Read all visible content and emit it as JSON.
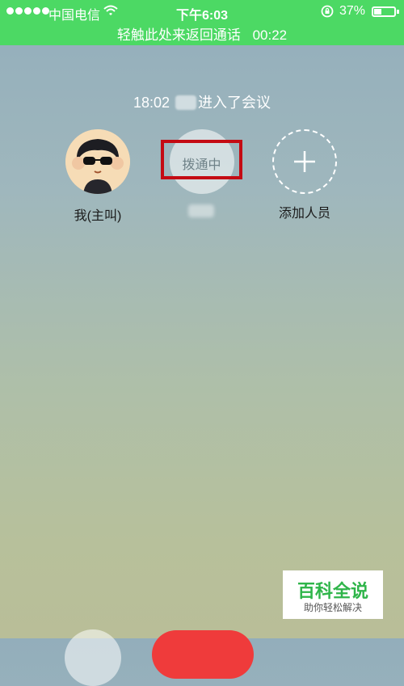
{
  "status_bar": {
    "carrier": "中国电信",
    "time": "下午6:03",
    "battery_percent": "37%",
    "battery_level": 0.37,
    "icons": [
      "signal-dots-icon",
      "wifi-icon",
      "rotation-lock-icon",
      "battery-icon"
    ],
    "background": "#4cd964"
  },
  "call_banner": {
    "text": "轻触此处来返回通话",
    "duration": "00:22"
  },
  "conference": {
    "time": "18:02",
    "message_suffix": "进入了会议"
  },
  "participants": {
    "me_label": "我(主叫)",
    "dialing_status": "拨通中",
    "add_label": "添加人员",
    "add_icon": "plus-icon"
  },
  "watermark": {
    "title": "百科全说",
    "subtitle": "助你轻松解决",
    "color": "#2fb54a"
  },
  "colors": {
    "highlight_box": "#c40b13",
    "hangup": "#ef3b3b"
  }
}
